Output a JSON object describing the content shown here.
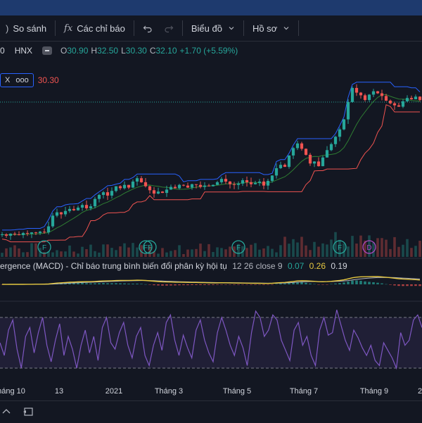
{
  "toolbar": {
    "compare_label": "So sánh",
    "indicators_icon": "fx",
    "indicators_label": "Các chỉ báo",
    "chart_label": "Biểu đồ",
    "profile_label": "Hồ sơ"
  },
  "legend": {
    "interval": "0",
    "exchange": "HNX",
    "o_label": "O",
    "o_value": "30.90",
    "h_label": "H",
    "h_value": "32.50",
    "l_label": "L",
    "l_value": "30.30",
    "c_label": "C",
    "c_value": "32.10",
    "change": "+1.70 (+5.59%)"
  },
  "ref_tag": {
    "value": "30.30"
  },
  "macd": {
    "title": "ergence (MACD) - Chỉ báo trung bình biến đổi phân kỳ hội tụ",
    "params": "12 26 close 9",
    "v1": "0.07",
    "v2": "0.26",
    "v3": "0.19"
  },
  "time_axis": [
    "háng 10",
    "13",
    "2021",
    "Tháng 3",
    "Tháng 5",
    "Tháng 7",
    "Tháng 9",
    "2"
  ],
  "event_markers": [
    "F",
    "F",
    "F",
    "F",
    "F",
    "D"
  ],
  "colors": {
    "up": "#26a69a",
    "down": "#ef5350",
    "macd": "#e6c840",
    "rsi": "#7e57c2",
    "accent": "#2962ff"
  },
  "chart_data": {
    "type": "line",
    "closes": [
      17,
      16.8,
      17.1,
      17.0,
      16.9,
      17.2,
      17.1,
      17.3,
      17.2,
      17.4,
      17.3,
      18.2,
      19.8,
      20.3,
      20.0,
      20.5,
      20.8,
      20.6,
      21.0,
      21.4,
      20.9,
      21.2,
      22.3,
      22.9,
      23.3,
      22.8,
      23.5,
      24.2,
      23.9,
      24.4,
      24.0,
      24.9,
      25.4,
      24.8,
      24.2,
      23.6,
      23.1,
      23.4,
      23.2,
      23.7,
      24.1,
      23.9,
      24.4,
      24.3,
      24.0,
      24.5,
      24.4,
      24.1,
      24.3,
      24.2,
      24.4,
      24.8,
      25.3,
      24.9,
      24.5,
      24.4,
      24.6,
      25.1,
      24.8,
      24.5,
      24.7,
      24.9,
      24.3,
      25.0,
      25.8,
      26.9,
      27.4,
      27.1,
      28.8,
      29.9,
      30.6,
      29.8,
      28.9,
      27.6,
      27.9,
      27.2,
      28.5,
      29.6,
      30.5,
      31.6,
      32.7,
      34.2,
      36.8,
      38.9,
      38.2,
      37.8,
      37.1,
      37.9,
      38.4,
      38.1,
      37.7,
      37.0,
      36.6,
      36.3,
      36.1,
      36.9,
      37.4,
      37.2,
      37.6,
      37.1
    ],
    "rsi": [
      50,
      40,
      60,
      68,
      45,
      30,
      55,
      62,
      42,
      58,
      70,
      48,
      35,
      52,
      65,
      40,
      55,
      45,
      30,
      48,
      60,
      42,
      55,
      36,
      62,
      70,
      50,
      45,
      58,
      66,
      48,
      38,
      55,
      62,
      40,
      32,
      48,
      58,
      44,
      66,
      72,
      52,
      40,
      56,
      46,
      38,
      60,
      68,
      52,
      42,
      35,
      58,
      70,
      60,
      48,
      40,
      55,
      46,
      32,
      58,
      75,
      70,
      55,
      60,
      72,
      68,
      52,
      44,
      36,
      60,
      66,
      48,
      55,
      40,
      32,
      60,
      70,
      56,
      58,
      76,
      64,
      52,
      44,
      60,
      54,
      46,
      40,
      48,
      36,
      32,
      50,
      44,
      38,
      30,
      58,
      48,
      52,
      68,
      72,
      62
    ]
  }
}
